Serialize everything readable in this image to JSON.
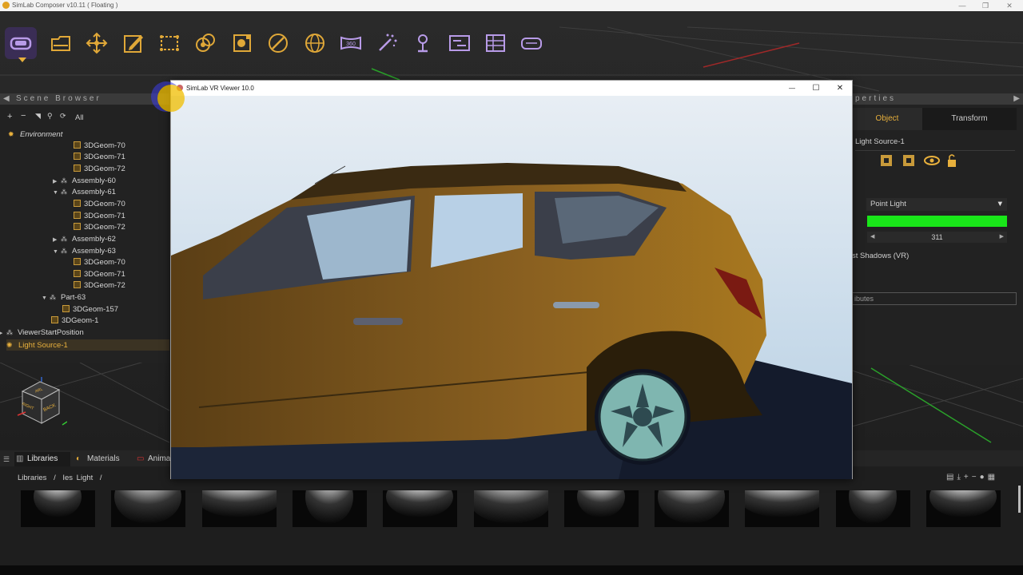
{
  "app": {
    "title": "SimLab Composer v10.11 ( Floating )",
    "window_min": "—",
    "window_max": "❐",
    "window_close": "✕"
  },
  "toolbar": {
    "tools": [
      {
        "name": "vr-headset-icon",
        "active": true
      },
      {
        "name": "open-folder-icon"
      },
      {
        "name": "move-icon"
      },
      {
        "name": "edit-icon"
      },
      {
        "name": "select-region-icon"
      },
      {
        "name": "materials-icon"
      },
      {
        "name": "texture-icon"
      },
      {
        "name": "measure-icon"
      },
      {
        "name": "globe-icon"
      },
      {
        "name": "panorama-360-icon"
      },
      {
        "name": "effects-icon"
      },
      {
        "name": "lamp-icon"
      },
      {
        "name": "timeline-icon"
      },
      {
        "name": "grid-layout-icon"
      },
      {
        "name": "vr-glasses-icon"
      }
    ]
  },
  "scene_browser": {
    "title": "Scene Browser",
    "filter": "All",
    "tree": [
      {
        "label": "Environment",
        "indent": 0,
        "kind": "env",
        "arrow": ""
      },
      {
        "label": "3DGeom-70",
        "indent": 3,
        "kind": "geom",
        "arrow": ""
      },
      {
        "label": "3DGeom-71",
        "indent": 3,
        "kind": "geom",
        "arrow": ""
      },
      {
        "label": "3DGeom-72",
        "indent": 3,
        "kind": "geom",
        "arrow": ""
      },
      {
        "label": "Assembly-60",
        "indent": 2,
        "kind": "asm",
        "arrow": "▶"
      },
      {
        "label": "Assembly-61",
        "indent": 2,
        "kind": "asm",
        "arrow": "▼"
      },
      {
        "label": "3DGeom-70",
        "indent": 3,
        "kind": "geom",
        "arrow": ""
      },
      {
        "label": "3DGeom-71",
        "indent": 3,
        "kind": "geom",
        "arrow": ""
      },
      {
        "label": "3DGeom-72",
        "indent": 3,
        "kind": "geom",
        "arrow": ""
      },
      {
        "label": "Assembly-62",
        "indent": 2,
        "kind": "asm",
        "arrow": "▶"
      },
      {
        "label": "Assembly-63",
        "indent": 2,
        "kind": "asm",
        "arrow": "▼"
      },
      {
        "label": "3DGeom-70",
        "indent": 3,
        "kind": "geom",
        "arrow": ""
      },
      {
        "label": "3DGeom-71",
        "indent": 3,
        "kind": "geom",
        "arrow": ""
      },
      {
        "label": "3DGeom-72",
        "indent": 3,
        "kind": "geom",
        "arrow": ""
      },
      {
        "label": "Part-63",
        "indent": 1,
        "kind": "asm",
        "arrow": "▼"
      },
      {
        "label": "3DGeom-157",
        "indent": 2,
        "kind": "geom",
        "arrow": ""
      },
      {
        "label": "3DGeom-1",
        "indent": 1,
        "kind": "geom",
        "arrow": ""
      },
      {
        "label": "ViewerStartPosition",
        "indent": 0,
        "kind": "asm",
        "arrow": "▶"
      },
      {
        "label": "Light Source-1",
        "indent": 0,
        "kind": "light",
        "arrow": "",
        "selected": true
      }
    ]
  },
  "viewcube": {
    "top": "ARL",
    "front": "RIGHT",
    "side": "BACK"
  },
  "properties": {
    "title": "Properties",
    "title_visible": "perties",
    "tabs": [
      "Object",
      "Transform"
    ],
    "object_name": "Light Source-1",
    "light_type": "Point Light",
    "light_color": "#19e619",
    "intensity_value": "311",
    "shadow_label": "st Shadows (VR)",
    "attributes_label": "ibutes"
  },
  "vr_viewer": {
    "title": "SimLab VR Viewer 10.0",
    "min": "—",
    "max": "☐",
    "close": "✕"
  },
  "bottom": {
    "tabs": [
      "Libraries",
      "Materials",
      "Anima"
    ],
    "breadcrumb": [
      "Libraries",
      "/",
      "Ies Light",
      "/"
    ],
    "thumbnail_count": 11
  }
}
